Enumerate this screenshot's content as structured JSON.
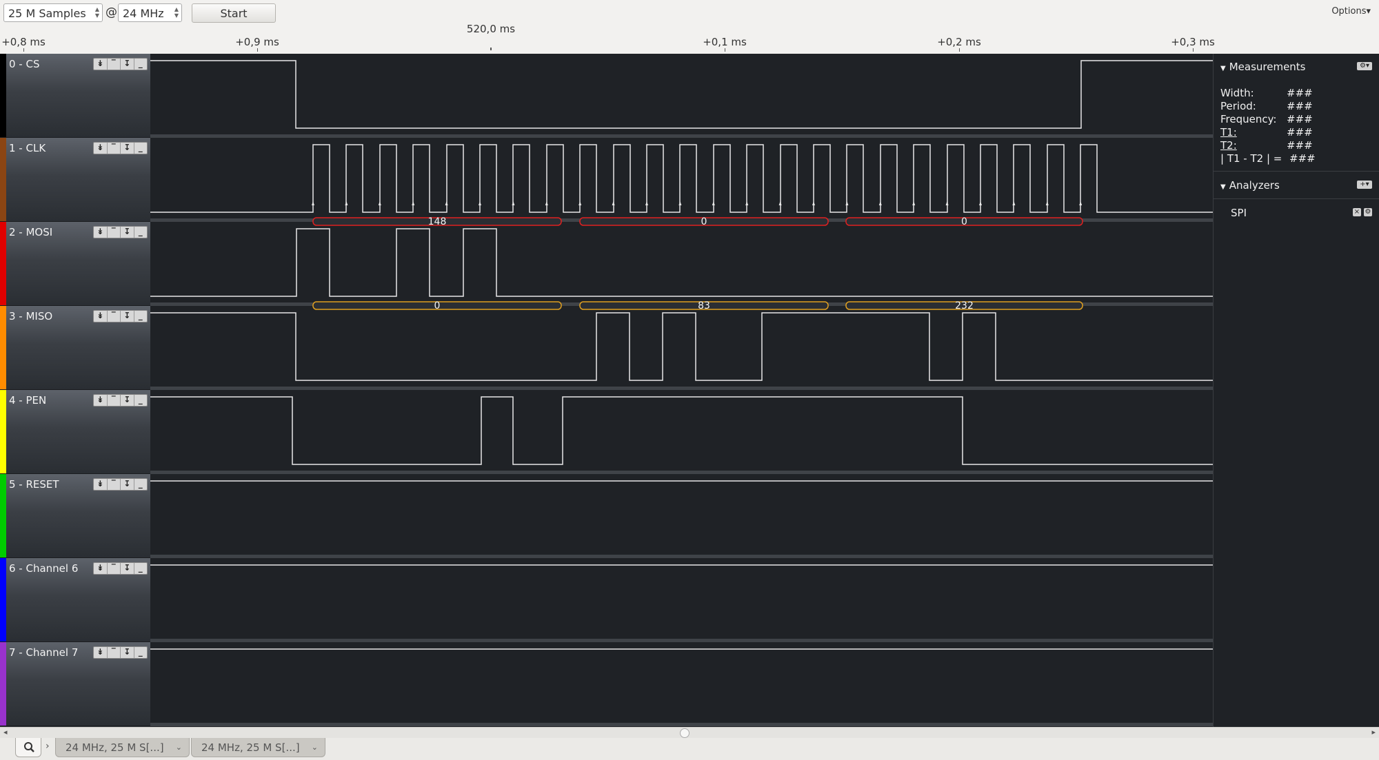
{
  "toolbar": {
    "samples_value": "25 M Samples",
    "at_symbol": "@",
    "rate_value": "24 MHz",
    "start_label": "Start",
    "options_label": "Options▾"
  },
  "ruler": {
    "center_label": "520,0 ms",
    "ticks": [
      "+0,8 ms",
      "+0,9 ms",
      "+0,1 ms",
      "+0,2 ms",
      "+0,3 ms"
    ]
  },
  "channels": [
    {
      "name": "0 - CS",
      "color": "#000000"
    },
    {
      "name": "1 - CLK",
      "color": "#8b4513"
    },
    {
      "name": "2 - MOSI",
      "color": "#e00000"
    },
    {
      "name": "3 - MISO",
      "color": "#ff8c00"
    },
    {
      "name": "4 - PEN",
      "color": "#ffff00"
    },
    {
      "name": "5 - RESET",
      "color": "#00cc00"
    },
    {
      "name": "6 - Channel 6",
      "color": "#0000ff"
    },
    {
      "name": "7 - Channel 7",
      "color": "#9932cc"
    }
  ],
  "channel_button_glyphs": [
    "↡",
    "‾",
    "↧",
    "_"
  ],
  "decoded": {
    "mosi": [
      "148",
      "0",
      "0"
    ],
    "miso": [
      "0",
      "83",
      "232"
    ],
    "mosi_color": "#e02020",
    "miso_color": "#e0a020"
  },
  "measurements": {
    "title": "Measurements",
    "rows": [
      {
        "label": "Width:",
        "value": "###"
      },
      {
        "label": "Period:",
        "value": "###"
      },
      {
        "label": "Frequency:",
        "value": "###"
      },
      {
        "label": "T1:",
        "value": "###"
      },
      {
        "label": "T2:",
        "value": "###"
      },
      {
        "label": "| T1 - T2 | =",
        "value": "###"
      }
    ]
  },
  "analyzers": {
    "title": "Analyzers",
    "items": [
      "SPI"
    ]
  },
  "tabs": [
    "24 MHz, 25 M S[...]",
    "24 MHz, 25 M S[...]"
  ]
}
